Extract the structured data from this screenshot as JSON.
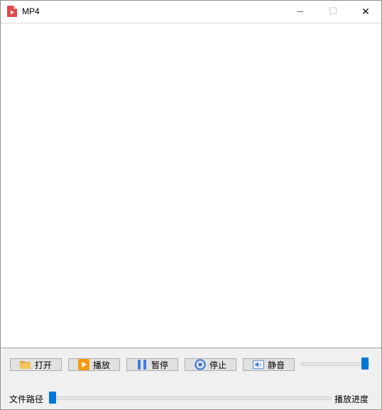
{
  "window": {
    "title": "MP4",
    "icon": "video-file-icon"
  },
  "titlebar": {
    "minimize_glyph": "—",
    "maximize_glyph": "☐",
    "close_glyph": "✕"
  },
  "controls": {
    "open": {
      "label": "打开",
      "icon": "folder-icon"
    },
    "play": {
      "label": "播放",
      "icon": "play-icon"
    },
    "pause": {
      "label": "暂停",
      "icon": "pause-icon"
    },
    "stop": {
      "label": "停止",
      "icon": "stop-icon"
    },
    "mute": {
      "label": "静音",
      "icon": "volume-icon"
    }
  },
  "volume": {
    "level": 1.0
  },
  "bottom": {
    "path_label": "文件路径",
    "progress_label": "播放进度",
    "progress": 0.0
  },
  "colors": {
    "accent": "#0078d7",
    "play_orange": "#f39c12",
    "pause_blue": "#3d7be4",
    "stop_blue": "#2a74d6",
    "icon_red": "#e04848"
  }
}
